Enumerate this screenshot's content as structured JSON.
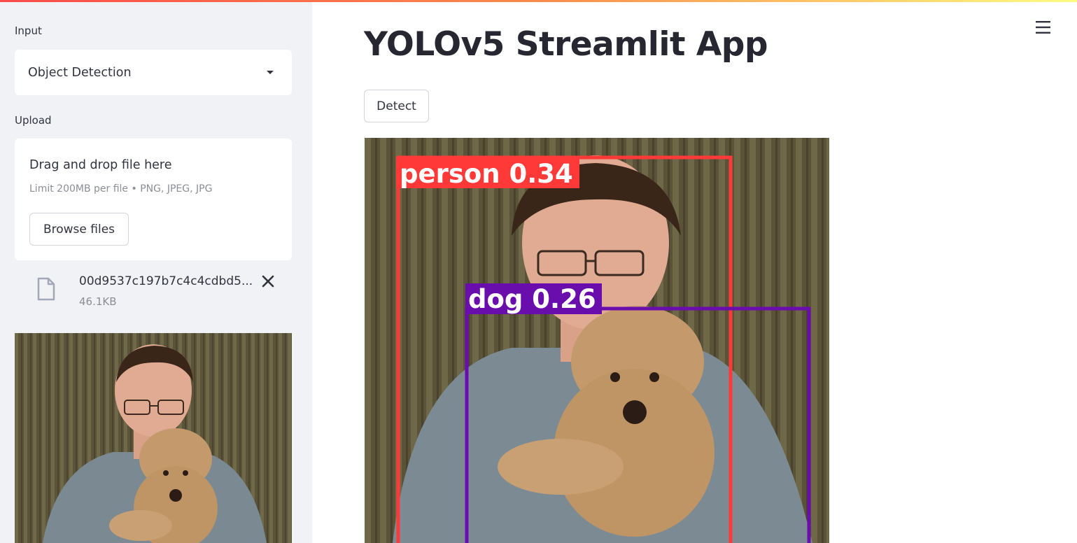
{
  "sidebar": {
    "input_label": "Input",
    "select": {
      "value": "Object Detection"
    },
    "upload_label": "Upload",
    "dropzone": {
      "title": "Drag and drop file here",
      "limit": "Limit 200MB per file • PNG, JPEG, JPG",
      "browse_label": "Browse files"
    },
    "file": {
      "name": "00d9537c197b7c4c4cdbd5...",
      "size": "46.1KB"
    },
    "preview": {
      "icon": "photo-person-with-dog"
    }
  },
  "main": {
    "title": "YOLOv5 Streamlit App",
    "detect_label": "Detect",
    "menu_icon": "hamburger-icon",
    "detections": [
      {
        "label": "person 0.34",
        "color": "#ff3838"
      },
      {
        "label": "dog 0.26",
        "color": "#6a0dad"
      }
    ]
  },
  "colors": {
    "accent": "#ff4b4b",
    "sidebar_bg": "#f0f2f6",
    "text": "#31333f"
  }
}
